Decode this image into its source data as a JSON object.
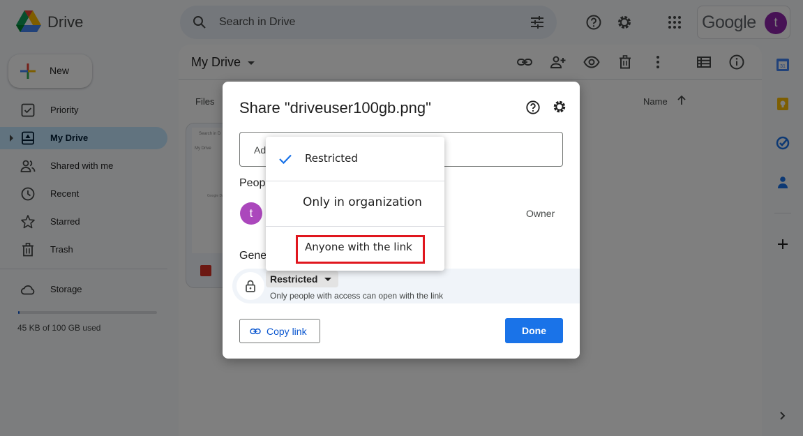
{
  "app": {
    "brand": "Drive",
    "account_initial": "t",
    "google_word": "Google"
  },
  "search": {
    "placeholder": "Search in Drive"
  },
  "sidebar": {
    "new_label": "New",
    "items": [
      {
        "label": "Priority",
        "icon": "priority-icon"
      },
      {
        "label": "My Drive",
        "icon": "my-drive-icon",
        "active": true
      },
      {
        "label": "Shared with me",
        "icon": "people-icon"
      },
      {
        "label": "Recent",
        "icon": "clock-icon"
      },
      {
        "label": "Starred",
        "icon": "star-icon"
      },
      {
        "label": "Trash",
        "icon": "trash-icon"
      },
      {
        "label": "Storage",
        "icon": "cloud-icon"
      }
    ],
    "storage_text": "45 KB of 100 GB used",
    "storage_fraction": 0.01
  },
  "main": {
    "title": "My Drive",
    "col_files": "Files",
    "col_name": "Name",
    "thumb_text1": "Search in D",
    "thumb_text2": "My Drive",
    "thumb_text3": "Google Dr"
  },
  "dialog": {
    "title": "Share \"driveuser100gb.png\"",
    "add_placeholder": "Ad",
    "people_heading": "Peop",
    "person_initial": "t",
    "owner_label": "Owner",
    "general_heading": "Gene",
    "access_selected": "Restricted",
    "access_description": "Only people with access can open with the link",
    "copy_link": "Copy link",
    "done": "Done"
  },
  "menu": {
    "options": [
      "Restricted",
      "Only in organization",
      "Anyone with the link"
    ],
    "selected_index": 0,
    "highlighted_index": 2
  },
  "colors": {
    "accent": "#1a73e8",
    "highlight_border": "#e0161e",
    "avatar": "#8e24aa"
  }
}
